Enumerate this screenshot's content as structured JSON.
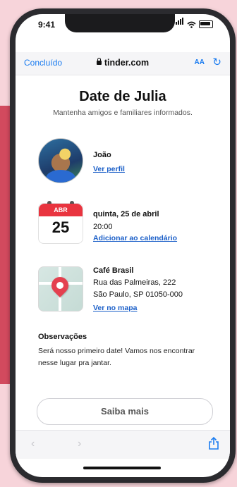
{
  "status_bar": {
    "time": "9:41"
  },
  "browser": {
    "done_label": "Concluído",
    "url": "tinder.com",
    "text_size_label": "AA"
  },
  "page": {
    "title": "Date de Julia",
    "subtitle": "Mantenha amigos e familiares informados."
  },
  "person": {
    "name": "João",
    "profile_link": "Ver perfil"
  },
  "event": {
    "month": "ABR",
    "day": "25",
    "date_text": "quinta, 25 de abril",
    "time_text": "20:00",
    "calendar_link": "Adicionar ao calendário"
  },
  "place": {
    "name": "Café Brasil",
    "street": "Rua das Palmeiras, 222",
    "city": "São Paulo, SP 01050-000",
    "map_link": "Ver no mapa"
  },
  "notes": {
    "title": "Observações",
    "text": "Será nosso primeiro date! Vamos nos encontrar nesse lugar pra jantar."
  },
  "actions": {
    "more_label": "Saiba mais"
  },
  "colors": {
    "accent": "#1b7cf0",
    "link": "#1b5fc8",
    "calendar_red": "#e9343f",
    "pin_red": "#e4404f"
  }
}
